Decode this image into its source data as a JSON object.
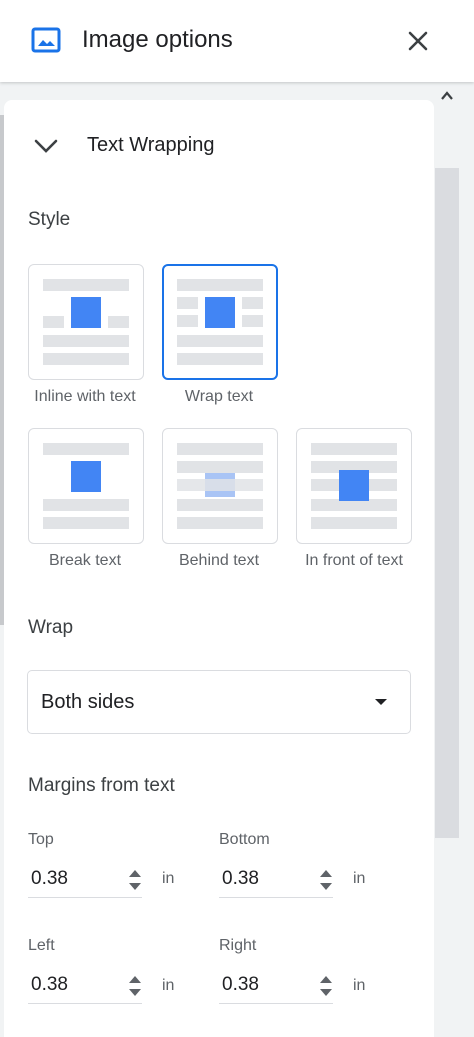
{
  "header": {
    "title": "Image options",
    "icon": "image-icon",
    "close_icon": "close-icon"
  },
  "section": {
    "title": "Text Wrapping",
    "expanded": true
  },
  "style": {
    "label": "Style",
    "options": [
      {
        "label": "Inline with text",
        "selected": false
      },
      {
        "label": "Wrap text",
        "selected": true
      },
      {
        "label": "Break text",
        "selected": false
      },
      {
        "label": "Behind text",
        "selected": false
      },
      {
        "label": "In front of text",
        "selected": false
      }
    ]
  },
  "wrap": {
    "label": "Wrap",
    "value": "Both sides"
  },
  "margins": {
    "label": "Margins from text",
    "top": {
      "label": "Top",
      "value": "0.38",
      "unit": "in"
    },
    "bottom": {
      "label": "Bottom",
      "value": "0.38",
      "unit": "in"
    },
    "left": {
      "label": "Left",
      "value": "0.38",
      "unit": "in"
    },
    "right": {
      "label": "Right",
      "value": "0.38",
      "unit": "in"
    }
  },
  "colors": {
    "accent": "#1a73e8",
    "image_blue": "#4285f4",
    "placeholder_gray": "#e1e3e6"
  }
}
